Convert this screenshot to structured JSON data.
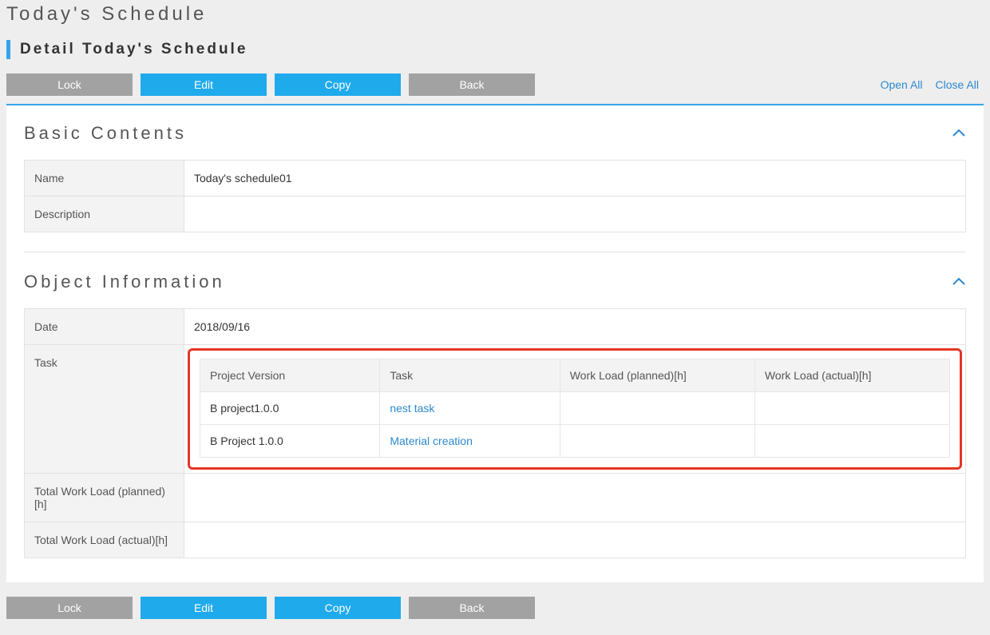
{
  "breadcrumb": "Today's Schedule",
  "subtitle": "Detail Today's Schedule",
  "toolbar": {
    "lock": "Lock",
    "edit": "Edit",
    "copy": "Copy",
    "back": "Back",
    "open_all": "Open All",
    "close_all": "Close All"
  },
  "sections": {
    "basic": {
      "title": "Basic Contents",
      "fields": {
        "name_label": "Name",
        "name_value": "Today's schedule01",
        "description_label": "Description",
        "description_value": ""
      }
    },
    "object": {
      "title": "Object Information",
      "fields": {
        "date_label": "Date",
        "date_value": "2018/09/16",
        "task_label": "Task",
        "total_planned_label": "Total Work Load (planned)[h]",
        "total_planned_value": "",
        "total_actual_label": "Total Work Load (actual)[h]",
        "total_actual_value": ""
      },
      "task_table": {
        "headers": {
          "project_version": "Project Version",
          "task": "Task",
          "workload_planned": "Work Load (planned)[h]",
          "workload_actual": "Work Load (actual)[h]"
        },
        "rows": [
          {
            "project_version": "B project1.0.0",
            "task": "nest task",
            "planned": "",
            "actual": ""
          },
          {
            "project_version": "B Project 1.0.0",
            "task": "Material creation",
            "planned": "",
            "actual": ""
          }
        ]
      }
    }
  }
}
